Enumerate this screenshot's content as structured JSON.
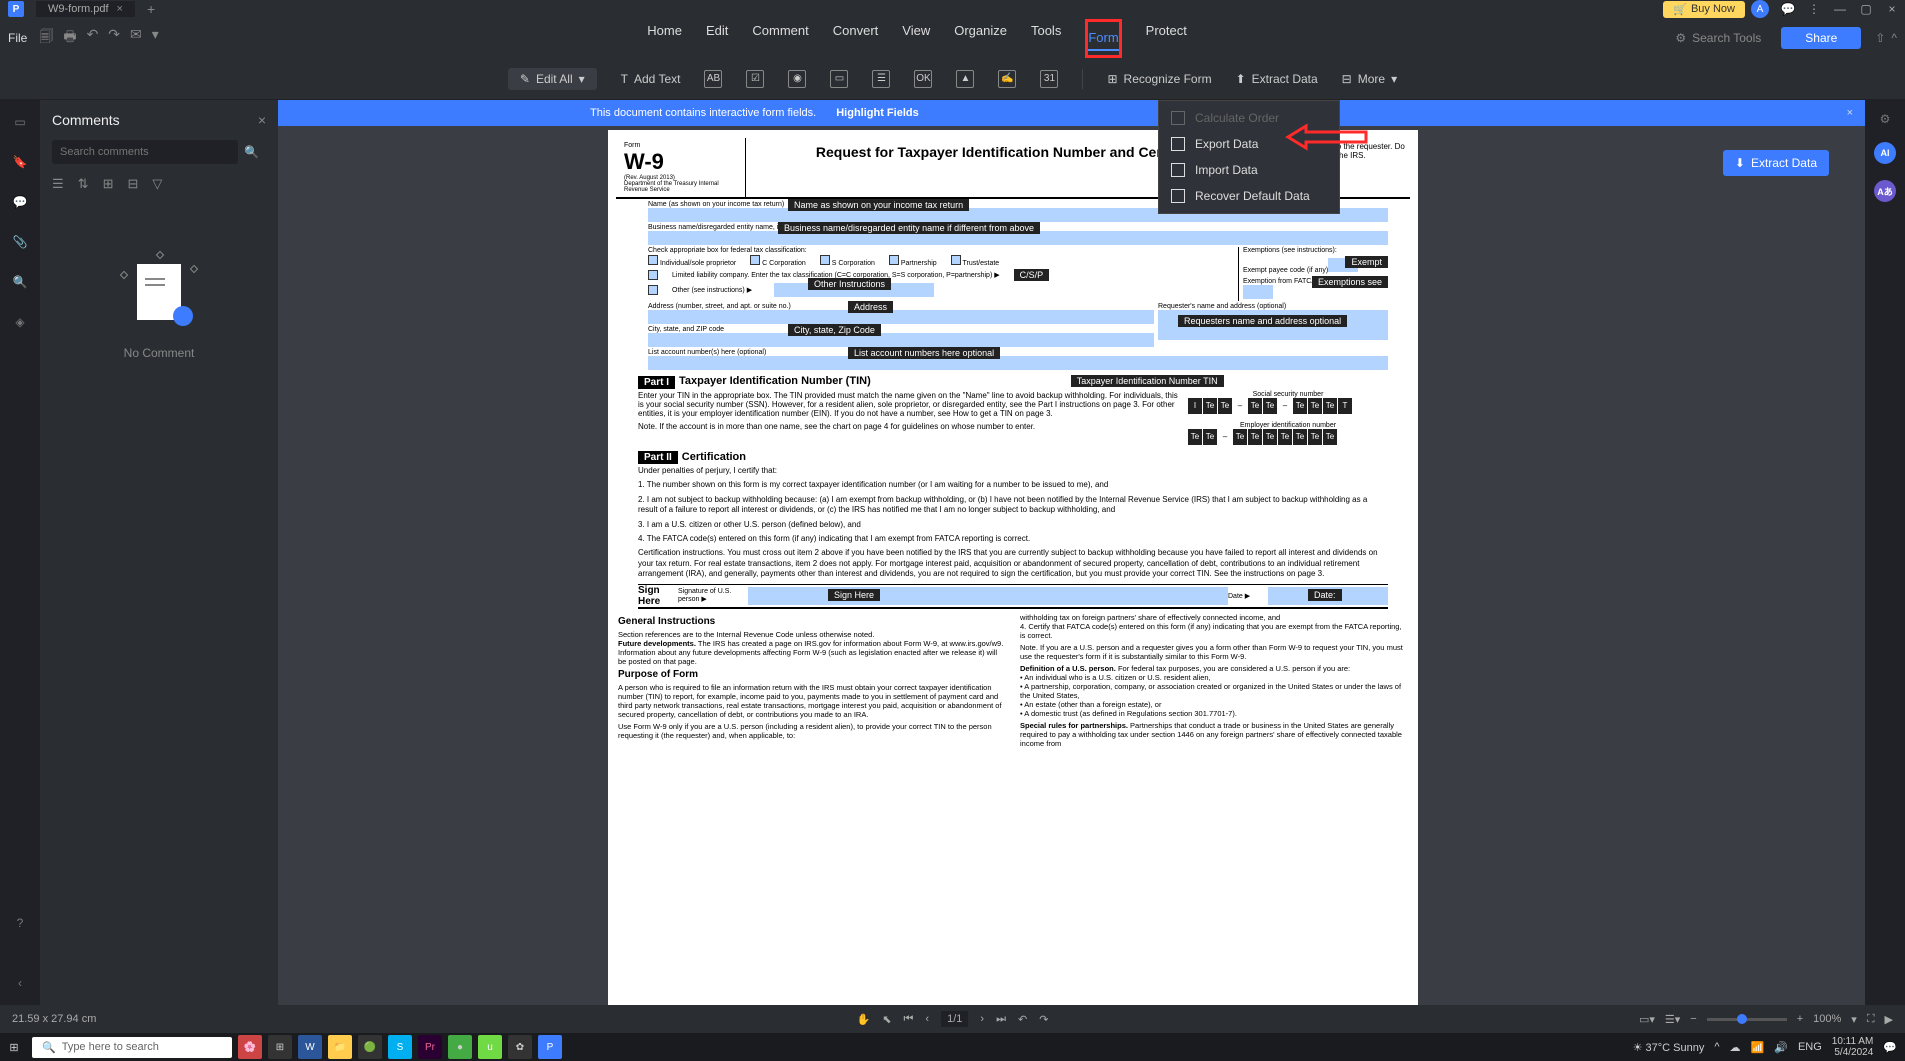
{
  "titlebar": {
    "tab_name": "W9-form.pdf",
    "buy_now": "Buy Now"
  },
  "menubar": {
    "file": "File",
    "items": [
      "Home",
      "Edit",
      "Comment",
      "Convert",
      "View",
      "Organize",
      "Tools",
      "Form",
      "Protect"
    ],
    "active_index": 8,
    "boxed_index": 8,
    "search_tools": "Search Tools",
    "share": "Share"
  },
  "toolbar": {
    "edit_all": "Edit All",
    "add_text": "Add Text",
    "recognize": "Recognize Form",
    "extract": "Extract Data",
    "more": "More"
  },
  "banner": {
    "text": "This document contains interactive form fields.",
    "highlight": "Highlight Fields"
  },
  "extract_button": "Extract Data",
  "more_menu": {
    "items": [
      {
        "label": "Calculate Order",
        "disabled": true
      },
      {
        "label": "Export Data",
        "disabled": false
      },
      {
        "label": "Import Data",
        "disabled": false
      },
      {
        "label": "Recover Default Data",
        "disabled": false
      }
    ]
  },
  "comments": {
    "title": "Comments",
    "search_placeholder": "Search comments",
    "empty": "No Comment"
  },
  "form": {
    "form_no": "W-9",
    "form_sub1": "Form",
    "form_sub2": "(Rev. August 2013)",
    "form_sub3": "Department of the Treasury Internal Revenue Service",
    "title": "Request for Taxpayer Identification Number and Certification",
    "give_to": "Give Form to the requester. Do not send to the IRS.",
    "labels": {
      "name": "Name (as shown on your income tax return)",
      "name_tip": "Name as shown on your income tax return",
      "business": "Business name/disregarded entity name, if different from above",
      "business_tip": "Business name/disregarded entity name if different from above",
      "check_appropriate": "Check appropriate box for federal tax classification:",
      "csp": "C/S/P",
      "individual": "Individual/sole proprietor",
      "ccorp": "C Corporation",
      "scorp": "S Corporation",
      "partnership": "Partnership",
      "trust": "Trust/estate",
      "llc": "Limited liability company. Enter the tax classification (C=C corporation, S=S corporation, P=partnership) ▶",
      "other": "Other (see instructions) ▶",
      "other_tip": "Other Instructions",
      "exemptions": "Exemptions (see instructions):",
      "exempt_payee": "Exempt payee code (if any)",
      "exempt_tip": "Exempt",
      "fatca": "Exemption from FATCA reporting code (if any)",
      "fatca_tip": "Exemptions see",
      "address": "Address (number, street, and apt. or suite no.)",
      "address_tip": "Address",
      "city": "City, state, and ZIP code",
      "city_tip": "City, state, Zip Code",
      "requester": "Requester's name and address (optional)",
      "requester_tip": "Requesters name and address optional",
      "list_acct": "List account number(s) here (optional)",
      "list_acct_tip": "List account numbers here optional"
    },
    "part1": {
      "hdr": "Part I",
      "title": "Taxpayer Identification Number (TIN)",
      "tip": "Taxpayer Identification Number TIN",
      "text": "Enter your TIN in the appropriate box. The TIN provided must match the name given on the \"Name\" line to avoid backup withholding. For individuals, this is your social security number (SSN). However, for a resident alien, sole proprietor, or disregarded entity, see the Part I instructions on page 3. For other entities, it is your employer identification number (EIN). If you do not have a number, see How to get a TIN on page 3.",
      "note": "Note. If the account is in more than one name, see the chart on page 4 for guidelines on whose number to enter.",
      "ssn_label": "Social security number",
      "ein_label": "Employer identification number",
      "cell": "Te"
    },
    "part2": {
      "hdr": "Part II",
      "title": "Certification",
      "lead": "Under penalties of perjury, I certify that:",
      "item1": "1.  The number shown on this form is my correct taxpayer identification number (or I am waiting for a number to be issued to me), and",
      "item2": "2.  I am not subject to backup withholding because: (a) I am exempt from backup withholding, or (b) I have not been notified by the Internal Revenue Service (IRS) that I am subject to backup withholding as a result of a failure to report all interest or dividends, or (c) the IRS has notified me that I am no longer subject to backup withholding, and",
      "item3": "3.  I am a U.S. citizen or other U.S. person (defined below), and",
      "item4": "4.  The FATCA code(s) entered on this form (if any) indicating that I am exempt from FATCA reporting is correct.",
      "cert": "Certification instructions. You must cross out item 2 above if you have been notified by the IRS that you are currently subject to backup withholding because you have failed to report all interest and dividends on your tax return. For real estate transactions, item 2 does not apply. For mortgage interest paid, acquisition or abandonment of secured property, cancellation of debt, contributions to an individual retirement arrangement (IRA), and generally, payments other than interest and dividends, you are not required to sign the certification, but you must provide your correct TIN. See the instructions on page 3.",
      "sign_here": "Sign Here",
      "sign_tip": "Sign Here",
      "sig_of": "Signature of U.S. person ▶",
      "date": "Date ▶",
      "date_tip": "Date:"
    },
    "instructions": {
      "general": "General Instructions",
      "sec_ref": "Section references are to the Internal Revenue Code unless otherwise noted.",
      "future_h": "Future developments.",
      "future": "The IRS has created a page on IRS.gov for information about Form W-9, at www.irs.gov/w9. Information about any future developments affecting Form W-9 (such as legislation enacted after we release it) will be posted on that page.",
      "purpose_h": "Purpose of Form",
      "purpose": "A person who is required to file an information return with the IRS must obtain your correct taxpayer identification number (TIN) to report, for example, income paid to you, payments made to you in settlement of payment card and third party network transactions, real estate transactions, mortgage interest you paid, acquisition or abandonment of secured property, cancellation of debt, or contributions you made to an IRA.",
      "use": "Use Form W-9 only if you are a U.S. person (including a resident alien), to provide your correct TIN to the person requesting it (the requester) and, when applicable, to:",
      "col2_1": "withholding tax on foreign partners' share of effectively connected income, and",
      "col2_2": "4. Certify that FATCA code(s) entered on this form (if any) indicating that you are exempt from the FATCA reporting, is correct.",
      "col2_note": "Note. If you are a U.S. person and a requester gives you a form other than Form W-9 to request your TIN, you must use the requester's form if it is substantially similar to this Form W-9.",
      "col2_def_h": "Definition of a U.S. person.",
      "col2_def": "For federal tax purposes, you are considered a U.S. person if you are:",
      "col2_b1": "• An individual who is a U.S. citizen or U.S. resident alien,",
      "col2_b2": "• A partnership, corporation, company, or association created or organized in the United States or under the laws of the United States,",
      "col2_b3": "• An estate (other than a foreign estate), or",
      "col2_b4": "• A domestic trust (as defined in Regulations section 301.7701-7).",
      "col2_sr_h": "Special rules for partnerships.",
      "col2_sr": "Partnerships that conduct a trade or business in the United States are generally required to pay a withholding tax under section 1446 on any foreign partners' share of effectively connected taxable income from"
    }
  },
  "statusbar": {
    "coords": "21.59 x 27.94 cm",
    "page_current": "1",
    "page_total": "/1",
    "zoom": "100%"
  },
  "taskbar": {
    "search": "Type here to search",
    "weather": "37°C  Sunny",
    "lang": "ENG",
    "time": "10:11 AM",
    "date": "5/4/2024"
  }
}
